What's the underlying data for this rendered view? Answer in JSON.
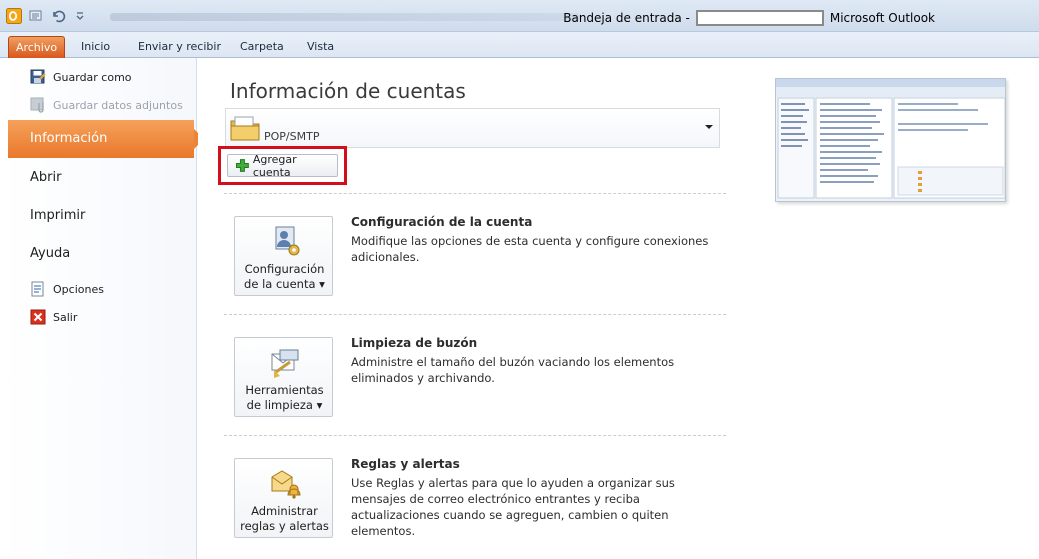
{
  "window": {
    "title_prefix": "Bandeja de entrada -",
    "title_app": "Microsoft Outlook"
  },
  "ribbon": {
    "tabs": [
      "Archivo",
      "Inicio",
      "Enviar y recibir",
      "Carpeta",
      "Vista"
    ]
  },
  "nav": {
    "save_as": "Guardar como",
    "save_attachments": "Guardar datos adjuntos",
    "info": "Información",
    "open": "Abrir",
    "print": "Imprimir",
    "help": "Ayuda",
    "options": "Opciones",
    "exit": "Salir"
  },
  "main": {
    "heading": "Información de cuentas",
    "account_label": "POP/SMTP",
    "add_account": "Agregar cuenta",
    "sections": [
      {
        "btn_line1": "Configuración",
        "btn_line2": "de la cuenta",
        "title": "Configuración de la cuenta",
        "desc": "Modifique las opciones de esta cuenta y configure conexiones adicionales."
      },
      {
        "btn_line1": "Herramientas",
        "btn_line2": "de limpieza",
        "title": "Limpieza de buzón",
        "desc": "Administre el tamaño del buzón vaciando los elementos eliminados y archivando."
      },
      {
        "btn_line1": "Administrar",
        "btn_line2": "reglas y alertas",
        "title": "Reglas y alertas",
        "desc": "Use Reglas y alertas para que lo ayuden a organizar sus mensajes de correo electrónico entrantes y reciba actualizaciones cuando se agreguen, cambien o quiten elementos."
      }
    ]
  },
  "colors": {
    "file_tab": "#d9571c",
    "nav_selected": "#e8782b",
    "highlight_border": "#d40f1c"
  }
}
